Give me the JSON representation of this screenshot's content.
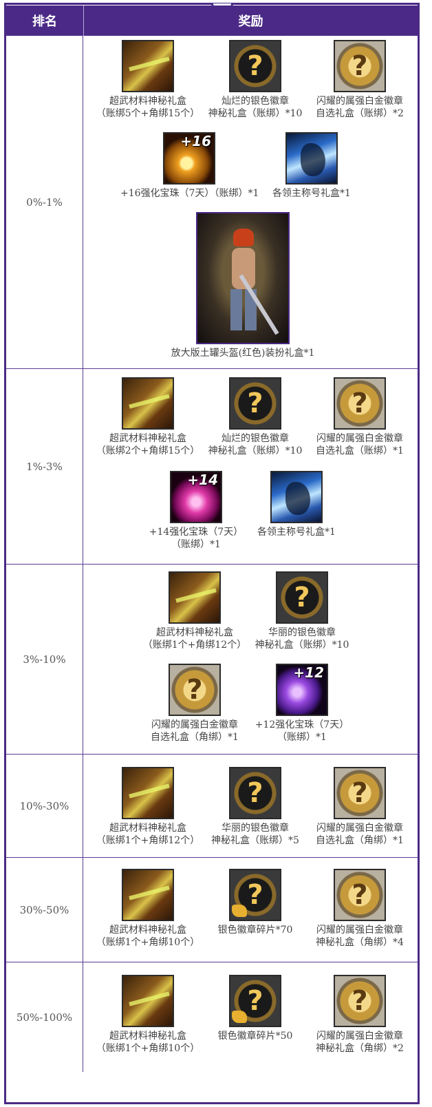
{
  "header": {
    "rank": "排名",
    "reward": "奖励"
  },
  "rows": [
    {
      "rank": "0%-1%",
      "items": [
        {
          "line1": "超武材料神秘礼盒",
          "line2": "（账绑5个+角绑15个）",
          "icon": "chest-icon"
        },
        {
          "line1": "灿烂的银色徽章",
          "line2": "神秘礼盒（账绑）*10",
          "icon": "silver-badge-box-icon"
        },
        {
          "line1": "闪耀的属强白金徽章",
          "line2": "自选礼盒（账绑）*2",
          "icon": "platinum-badge-box-icon"
        },
        {
          "line1": "+16强化宝珠（7天）（账绑）*1",
          "line2": "",
          "icon": "orb-icon",
          "plus": "+16"
        },
        {
          "line1": "各领主称号礼盒*1",
          "line2": "",
          "icon": "dragon-title-icon"
        },
        {
          "line1": "放大版土罐头盔(红色)装扮礼盒*1",
          "line2": "",
          "icon": "avatar-costume-icon"
        }
      ]
    },
    {
      "rank": "1%-3%",
      "items": [
        {
          "line1": "超武材料神秘礼盒",
          "line2": "（账绑2个+角绑15个）",
          "icon": "chest-icon"
        },
        {
          "line1": "灿烂的银色徽章",
          "line2": "神秘礼盒（账绑）*10",
          "icon": "silver-badge-box-icon"
        },
        {
          "line1": "闪耀的属强白金徽章",
          "line2": "自选礼盒（账绑）*1",
          "icon": "platinum-badge-box-icon"
        },
        {
          "line1": "+14强化宝珠（7天）",
          "line2": "（账绑）*1",
          "icon": "orb-icon",
          "plus": "+14"
        },
        {
          "line1": "各领主称号礼盒*1",
          "line2": "",
          "icon": "dragon-title-icon"
        }
      ]
    },
    {
      "rank": "3%-10%",
      "items": [
        {
          "line1": "超武材料神秘礼盒",
          "line2": "（账绑1个+角绑12个）",
          "icon": "chest-icon"
        },
        {
          "line1": "华丽的银色徽章",
          "line2": "神秘礼盒（账绑）*10",
          "icon": "silver-badge-box-icon"
        },
        {
          "line1": "闪耀的属强白金徽章",
          "line2": "自选礼盒（角绑）*1",
          "icon": "platinum-badge-box-icon"
        },
        {
          "line1": "+12强化宝珠（7天）",
          "line2": "（账绑）*1",
          "icon": "orb-icon",
          "plus": "+12"
        }
      ]
    },
    {
      "rank": "10%-30%",
      "items": [
        {
          "line1": "超武材料神秘礼盒",
          "line2": "（账绑1个+角绑12个）",
          "icon": "chest-icon"
        },
        {
          "line1": "华丽的银色徽章",
          "line2": "神秘礼盒（账绑）*5",
          "icon": "silver-badge-box-icon"
        },
        {
          "line1": "闪耀的属强白金徽章",
          "line2": "自选礼盒（角绑）*1",
          "icon": "platinum-badge-box-icon"
        }
      ]
    },
    {
      "rank": "30%-50%",
      "items": [
        {
          "line1": "超武材料神秘礼盒",
          "line2": "（账绑1个+角绑10个）",
          "icon": "chest-icon"
        },
        {
          "line1": "银色徽章碎片*70",
          "line2": "",
          "icon": "badge-fragment-icon"
        },
        {
          "line1": "闪耀的属强白金徽章",
          "line2": "神秘礼盒（角绑）*4",
          "icon": "platinum-badge-box-icon"
        }
      ]
    },
    {
      "rank": "50%-100%",
      "items": [
        {
          "line1": "超武材料神秘礼盒",
          "line2": "（账绑1个+角绑10个）",
          "icon": "chest-icon"
        },
        {
          "line1": "银色徽章碎片*50",
          "line2": "",
          "icon": "badge-fragment-icon"
        },
        {
          "line1": "闪耀的属强白金徽章",
          "line2": "神秘礼盒（角绑）*2",
          "icon": "platinum-badge-box-icon"
        }
      ]
    }
  ]
}
